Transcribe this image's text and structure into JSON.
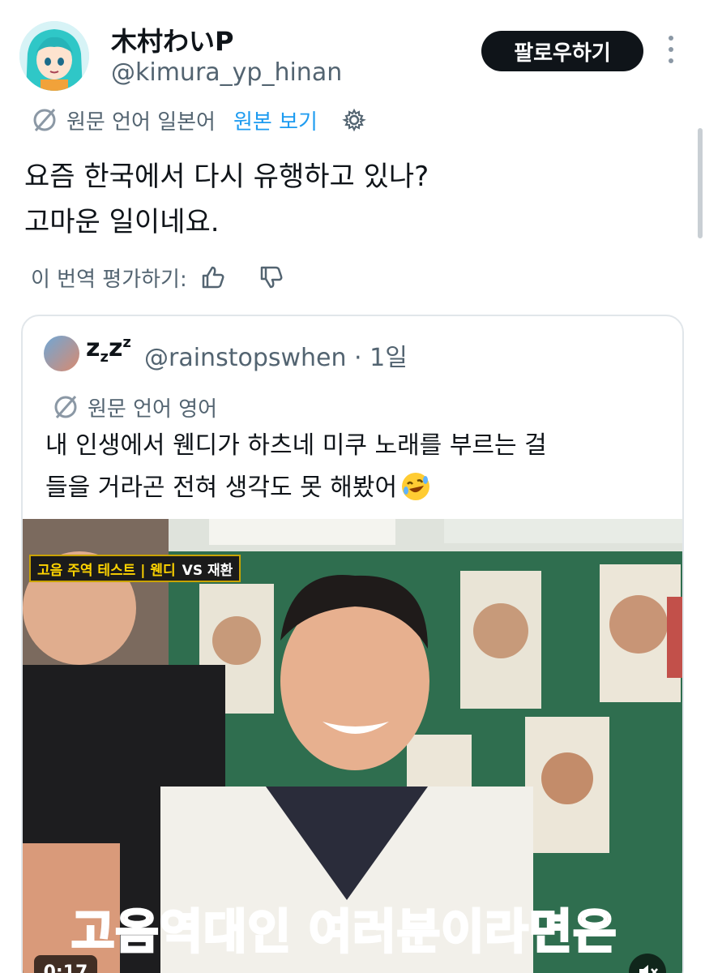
{
  "author": {
    "display_name": "木村わいP",
    "handle": "@kimura_yp_hinan"
  },
  "header": {
    "follow_label": "팔로우하기",
    "more_icon": "more-vertical-icon"
  },
  "translation": {
    "source_label": "원문 언어 일본어",
    "show_original_label": "원본 보기",
    "settings_icon": "gear-icon"
  },
  "tweet": {
    "lines": [
      "요즘 한국에서 다시 유행하고 있나?",
      "고마운 일이네요."
    ]
  },
  "rating": {
    "label": "이 번역 평가하기:",
    "like_icon": "thumbs-up-icon",
    "dislike_icon": "thumbs-down-icon"
  },
  "quote": {
    "display_name": "zzzz",
    "handle_time": "@rainstopswhen · 1일",
    "translation_label": "원문 언어 영어",
    "lines": [
      "내 인생에서 웬디가 하츠네 미쿠 노래를 부르는 걸",
      "들을 거라곤 전혀 생각도 못 해봤어"
    ],
    "emoji": "rolling-on-floor-laughing-emoji"
  },
  "video": {
    "top_caption_left": "고음 주역 테스트 | 웬디",
    "top_caption_right": "VS 재환",
    "subtitle": "고음역대인 여러분이라면은",
    "timestamp": "0:17",
    "mute_icon": "muted-speaker-icon"
  },
  "colors": {
    "link": "#1d9bf0",
    "muted_text": "#536471",
    "button_bg": "#0f1419",
    "subtitle_red": "#e8331f"
  }
}
